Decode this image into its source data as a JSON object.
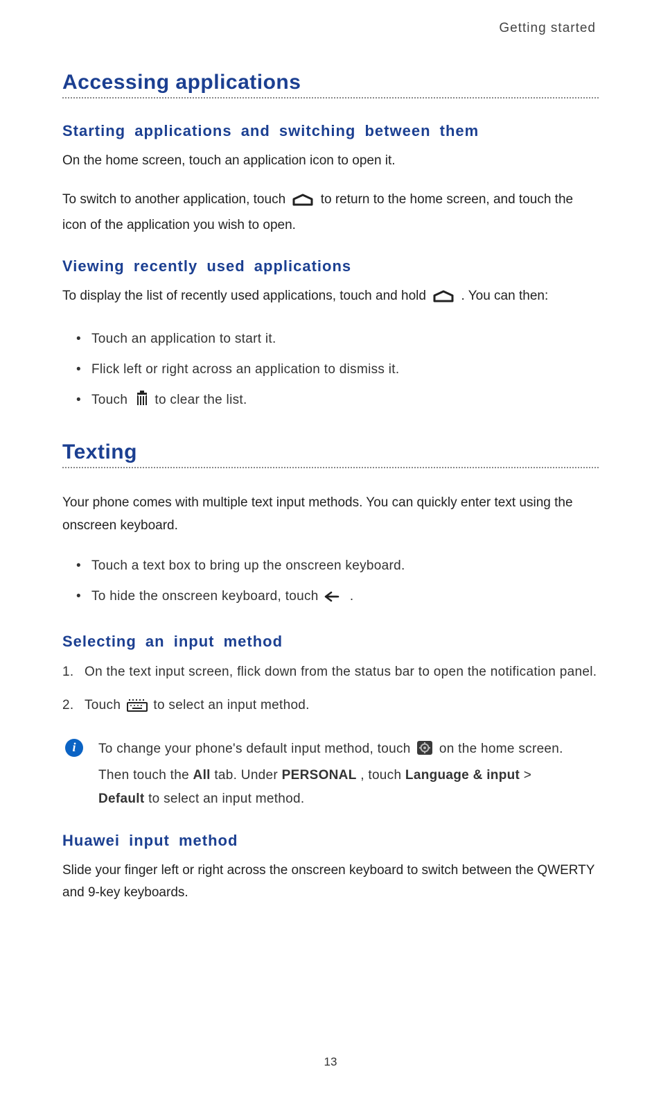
{
  "runningHeader": "Getting started",
  "pageNumber": "13",
  "section1": {
    "title": "Accessing applications",
    "sub1": {
      "heading": "Starting applications and switching between them",
      "p1": "On the home screen, touch an application icon to open it.",
      "p2a": "To switch to another application, touch ",
      "p2b": " to return to the home screen, and touch the icon of the application you wish to open."
    },
    "sub2": {
      "heading": "Viewing recently used applications",
      "p1a": "To display the list of recently used applications, touch and hold ",
      "p1b": ". You can then:",
      "bullets": {
        "b1": "Touch an application to start it.",
        "b2": "Flick left or right across an application to dismiss it.",
        "b3a": "Touch ",
        "b3b": " to clear the list."
      }
    }
  },
  "section2": {
    "title": "Texting",
    "p1": "Your phone comes with multiple text input methods. You can quickly enter text using the onscreen keyboard.",
    "bullets": {
      "b1": "Touch a text box to bring up the onscreen keyboard.",
      "b2a": "To hide the onscreen keyboard, touch ",
      "b2b": "."
    },
    "sub1": {
      "heading": "Selecting an input method",
      "steps": {
        "s1": "On the text input screen, flick down from the status bar to open the notification panel.",
        "s2a": "Touch ",
        "s2b": " to select an input method."
      },
      "info": {
        "a": "To change your phone's default input method, touch ",
        "b": " on the home screen. Then touch the ",
        "allTab": "All",
        "c": " tab. Under ",
        "personal": "PERSONAL",
        "d": ", touch ",
        "langInput": "Language & input",
        "e": " > ",
        "default": "Default",
        "f": " to select an input method."
      }
    },
    "sub2": {
      "heading": "Huawei input method",
      "p1": "Slide your finger left or right across the onscreen keyboard to switch between the QWERTY and 9-key keyboards."
    }
  }
}
